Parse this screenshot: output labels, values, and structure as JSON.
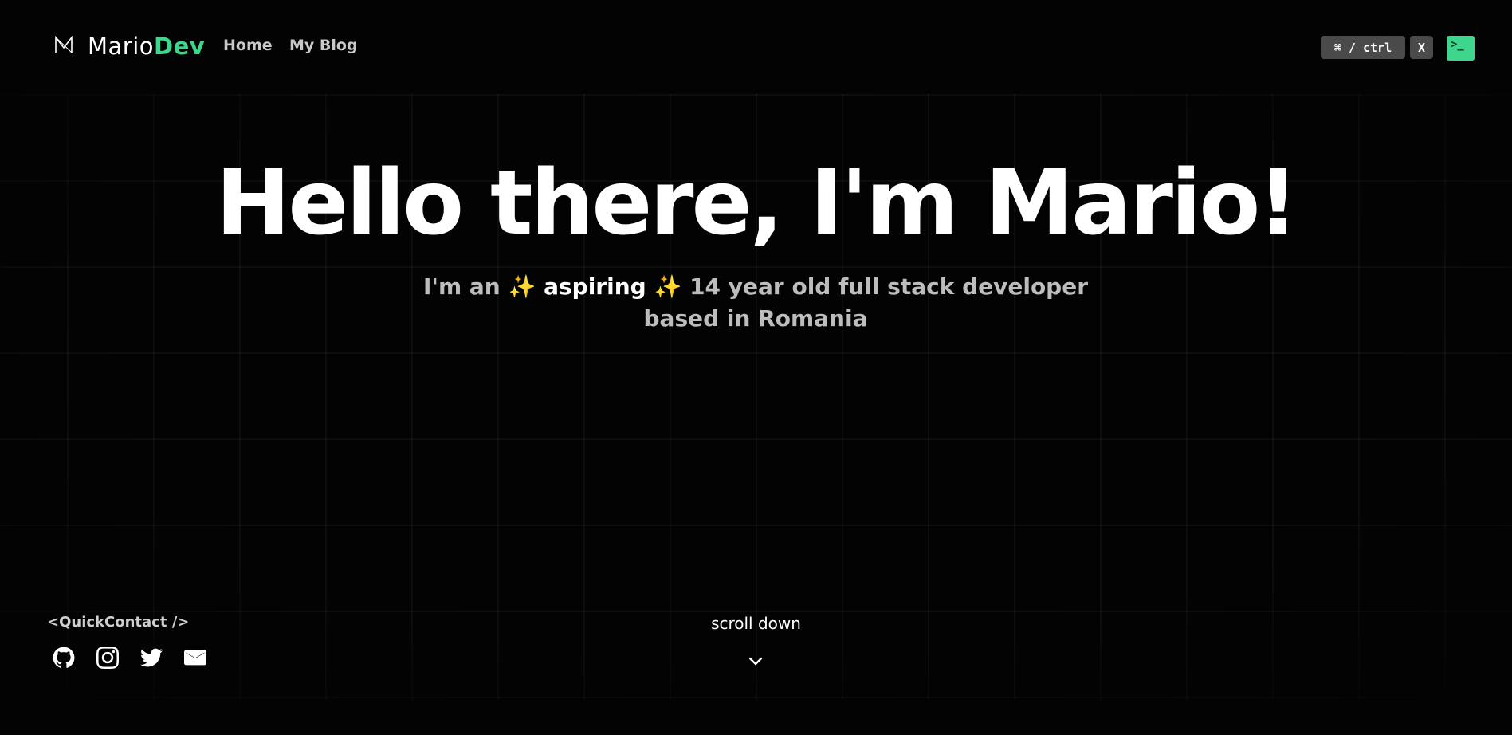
{
  "header": {
    "brand_main": "Mario",
    "brand_accent": "Dev",
    "nav": [
      {
        "label": "Home"
      },
      {
        "label": "My Blog"
      }
    ],
    "shortcut_key": "⌘ / ctrl",
    "shortcut_key2": "X",
    "terminal_glyph": ">_"
  },
  "hero": {
    "title": "Hello there, I'm Mario!",
    "subtitle_prefix": "I'm an",
    "sparkle": "✨",
    "subtitle_highlight": "aspiring",
    "subtitle_suffix": "14 year old full stack developer based in Romania"
  },
  "quick_contact": {
    "title": "<QuickContact />",
    "links": [
      {
        "icon": "github-icon"
      },
      {
        "icon": "instagram-icon"
      },
      {
        "icon": "twitter-icon"
      },
      {
        "icon": "mail-icon"
      }
    ]
  },
  "scroll": {
    "label": "scroll down",
    "icon": "chevron-down-icon"
  },
  "colors": {
    "accent": "#3dd68c",
    "background": "#030303",
    "kbd": "#4a4a4a"
  }
}
